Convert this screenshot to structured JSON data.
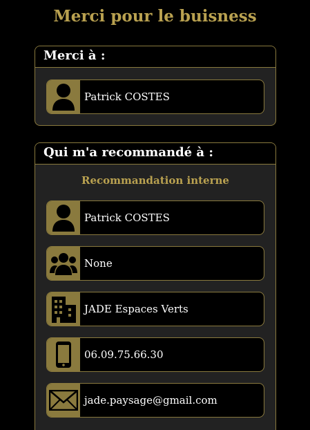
{
  "page": {
    "title": "Merci pour le buisness"
  },
  "thanked_card": {
    "header": "Merci à :",
    "person": {
      "icon": "user-icon",
      "name": "Patrick COSTES"
    }
  },
  "referrer_card": {
    "header": "Qui m'a recommandé à :",
    "subtitle": "Recommandation interne",
    "rows": [
      {
        "icon": "user-icon",
        "value": "Patrick COSTES"
      },
      {
        "icon": "users-group-icon",
        "value": "None"
      },
      {
        "icon": "buildings-icon",
        "value": "JADE Espaces Verts"
      },
      {
        "icon": "mobile-phone-icon",
        "value": "06.09.75.66.30"
      },
      {
        "icon": "envelope-icon",
        "value": "jade.paysage@gmail.com"
      }
    ]
  },
  "colors": {
    "background": "#000000",
    "accent_gold": "#b9a150",
    "icon_bg_gold": "#8a7a3e",
    "card_bg": "#222222",
    "text": "#ffffff"
  }
}
